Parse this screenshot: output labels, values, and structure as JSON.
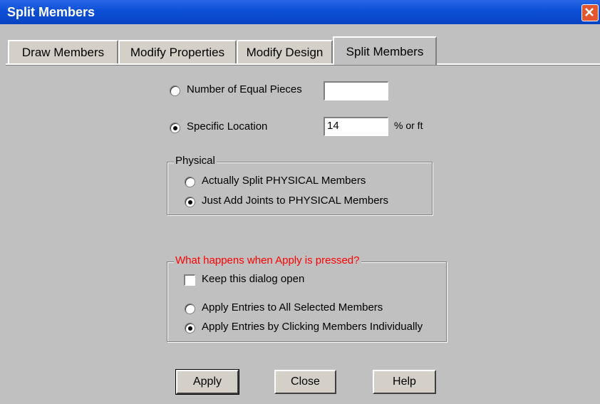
{
  "window": {
    "title": "Split Members"
  },
  "tabs": [
    {
      "label": "Draw Members"
    },
    {
      "label": "Modify Properties"
    },
    {
      "label": "Modify Design"
    },
    {
      "label": "Split Members"
    }
  ],
  "split": {
    "equal_pieces_label": "Number of Equal Pieces",
    "equal_pieces_value": "",
    "specific_location_label": "Specific Location",
    "specific_location_value": "14",
    "unit_label": "% or ft",
    "selected_mode": "specific_location"
  },
  "physical": {
    "title": "Physical",
    "options": [
      {
        "label": "Actually Split PHYSICAL Members",
        "selected": false
      },
      {
        "label": "Just Add Joints to PHYSICAL Members",
        "selected": true
      }
    ]
  },
  "apply_group": {
    "title": "What happens when Apply is pressed?",
    "title_color": "#ff0000",
    "keep_open_label": "Keep this dialog open",
    "keep_open_checked": false,
    "options": [
      {
        "label": "Apply Entries to All Selected Members",
        "selected": false
      },
      {
        "label": "Apply Entries by Clicking Members Individually",
        "selected": true
      }
    ]
  },
  "buttons": {
    "apply": "Apply",
    "close": "Close",
    "help": "Help"
  }
}
